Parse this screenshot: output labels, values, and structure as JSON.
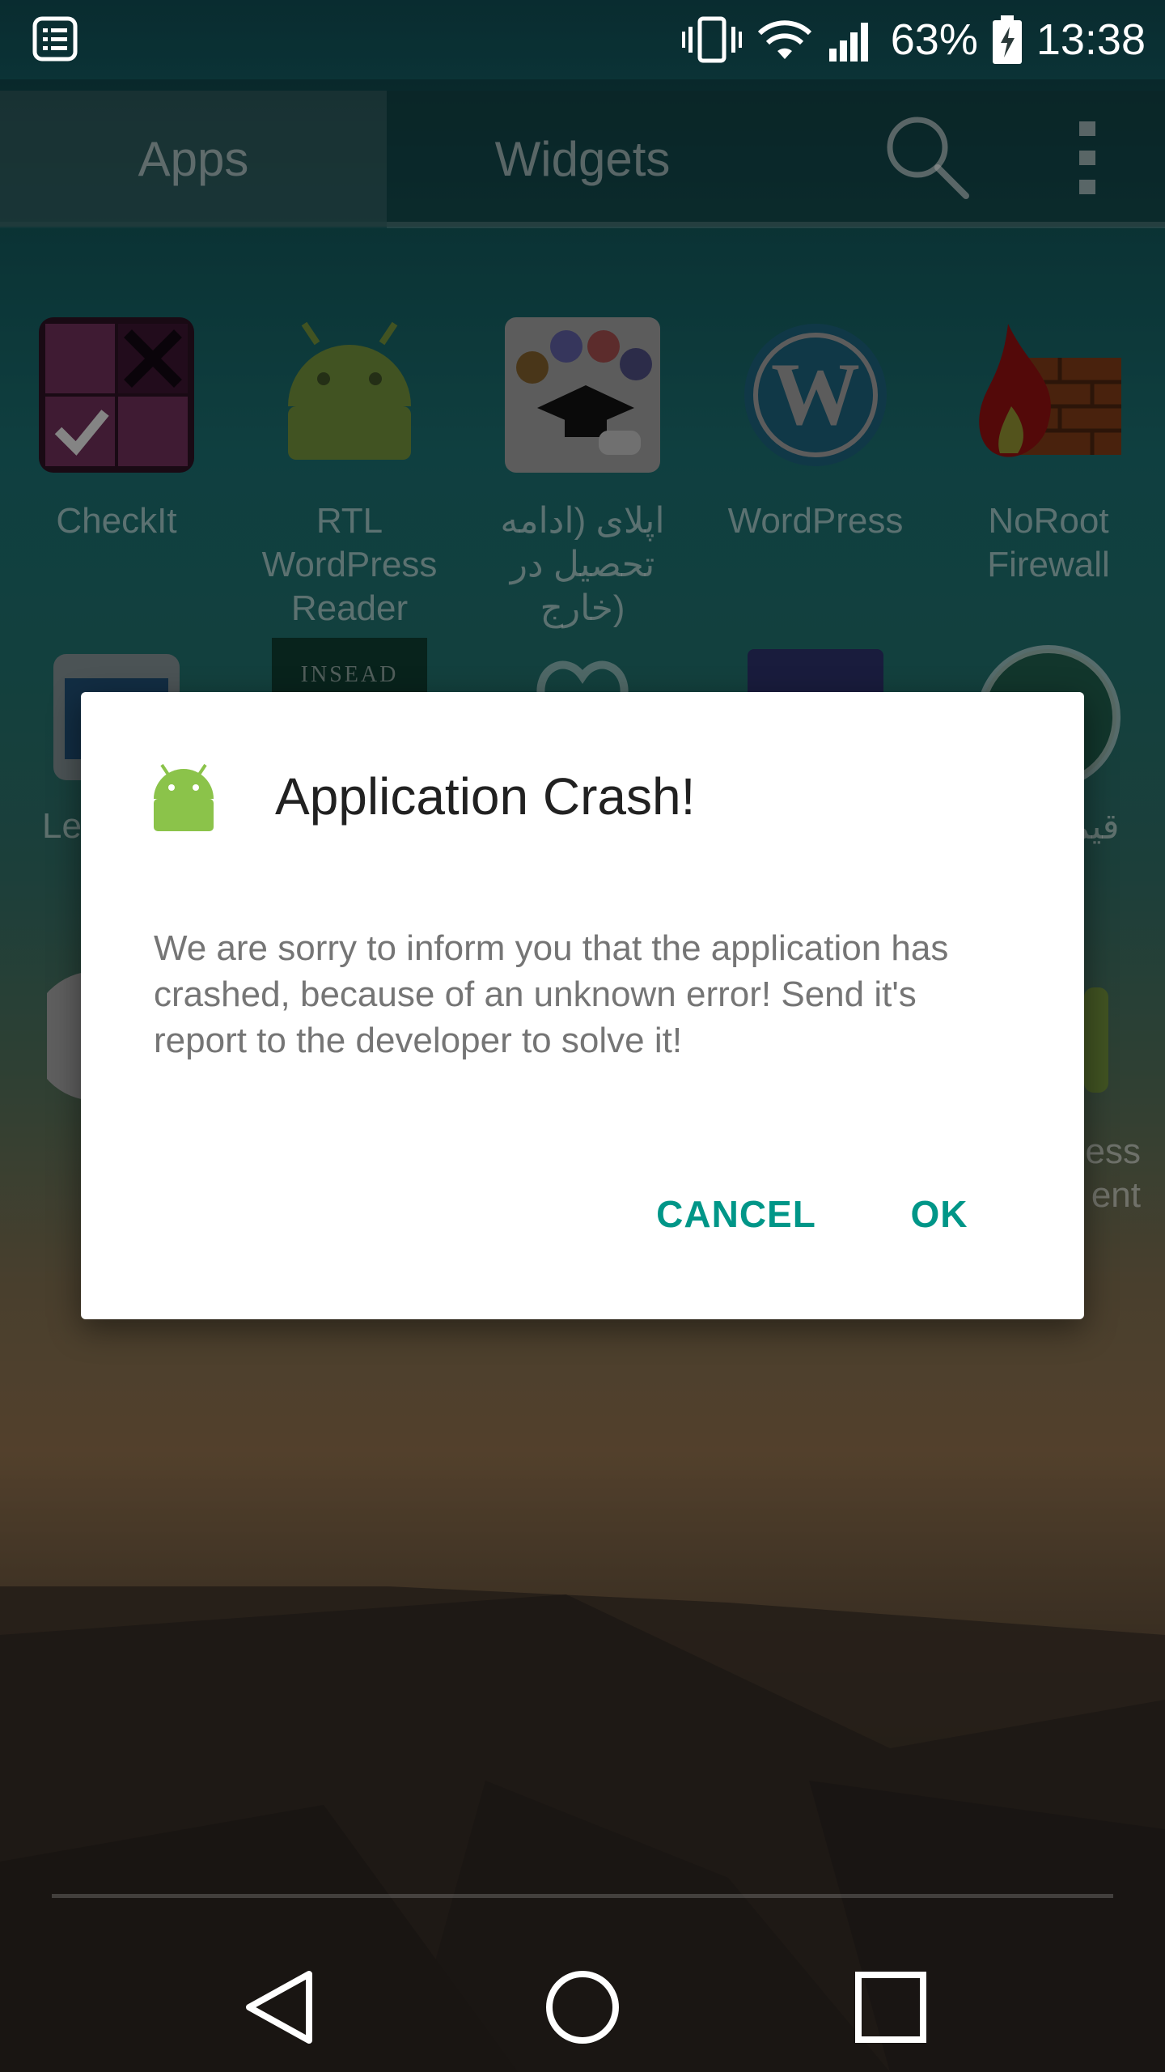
{
  "status_bar": {
    "battery": "63%",
    "time": "13:38"
  },
  "tabs": {
    "apps": "Apps",
    "widgets": "Widgets"
  },
  "apps": [
    {
      "label_line1": "CheckIt",
      "label_line2": ""
    },
    {
      "label_line1": "RTL WordPress",
      "label_line2": "Reader"
    },
    {
      "label_line1": "اپلای (ادامه",
      "label_line2": "تحصیل در خارج)"
    },
    {
      "label_line1": "WordPress",
      "label_line2": ""
    },
    {
      "label_line1": "NoRoot",
      "label_line2": "Firewall"
    }
  ],
  "partial_labels": {
    "row2_left": "Le",
    "row2_right": "قیم",
    "row3_right_line1": "ess",
    "row3_right_line2": "ent",
    "insead": "INSEAD"
  },
  "dialog": {
    "title": "Application Crash!",
    "message": "We are sorry to inform you that the application has crashed, because of an unknown error! Send it's report to the developer to solve it!",
    "cancel_label": "CANCEL",
    "ok_label": "OK"
  },
  "colors": {
    "accent": "#009688",
    "android_green": "#8BC34A"
  }
}
